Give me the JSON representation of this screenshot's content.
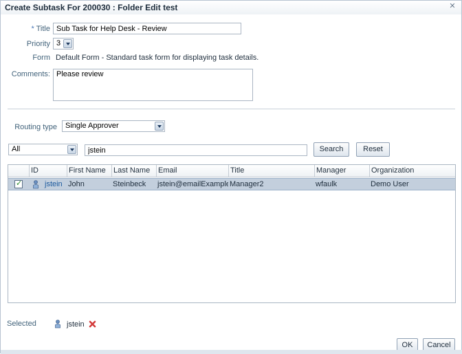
{
  "dialog": {
    "title": "Create Subtask For 200030 : Folder Edit test",
    "close_glyph": "✕"
  },
  "form": {
    "title_required": "*",
    "title_label": "Title",
    "title_value": "Sub Task for Help Desk - Review",
    "priority_label": "Priority",
    "priority_value": "3",
    "form_label": "Form",
    "form_value": "Default Form - Standard task form for displaying task details.",
    "comments_label": "Comments:",
    "comments_value": "Please review"
  },
  "routing": {
    "label": "Routing type",
    "value": "Single Approver"
  },
  "search": {
    "filter_value": "All",
    "query_value": "jstein",
    "search_label": "Search",
    "reset_label": "Reset"
  },
  "table": {
    "columns": [
      "ID",
      "First Name",
      "Last Name",
      "Email",
      "Title",
      "Manager",
      "Organization"
    ],
    "rows": [
      {
        "selected": true,
        "id": "jstein",
        "first_name": "John",
        "last_name": "Steinbeck",
        "email": "jstein@emailExample.com",
        "title": "Manager2",
        "manager": "wfaulk",
        "organization": "Demo User"
      }
    ]
  },
  "selected": {
    "label": "Selected",
    "user": "jstein",
    "remove_icon": "red-x-icon"
  },
  "actions": {
    "ok_label": "OK",
    "cancel_label": "Cancel"
  },
  "colors": {
    "label": "#41627a",
    "row_selected": "#c3cfdd",
    "link": "#1c5a9e",
    "remove": "#d33b3b"
  }
}
